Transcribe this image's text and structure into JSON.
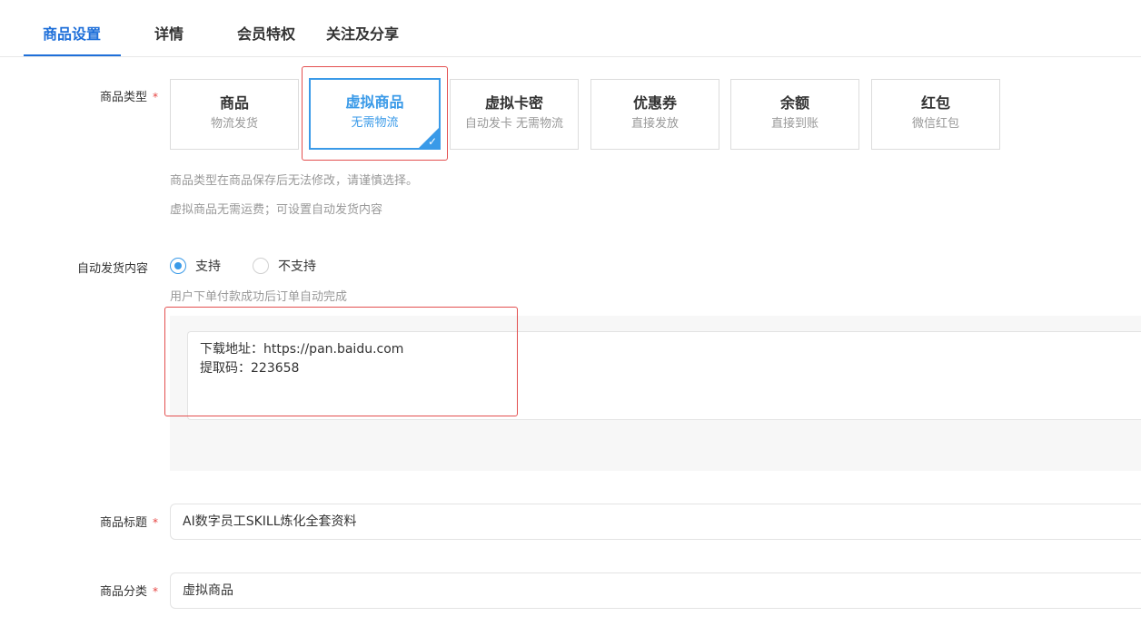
{
  "tabs": [
    {
      "label": "商品设置"
    },
    {
      "label": "详情"
    },
    {
      "label": "会员特权"
    },
    {
      "label": "关注及分享"
    }
  ],
  "product_type": {
    "label": "商品类型",
    "required_mark": "*",
    "options": [
      {
        "title": "商品",
        "subtitle": "物流发货"
      },
      {
        "title": "虚拟商品",
        "subtitle": "无需物流"
      },
      {
        "title": "虚拟卡密",
        "subtitle": "自动发卡 无需物流"
      },
      {
        "title": "优惠券",
        "subtitle": "直接发放"
      },
      {
        "title": "余额",
        "subtitle": "直接到账"
      },
      {
        "title": "红包",
        "subtitle": "微信红包"
      }
    ],
    "selected_index": 1,
    "check_mark": "✓",
    "help_1": "商品类型在商品保存后无法修改，请谨慎选择。",
    "help_2": "虚拟商品无需运费；可设置自动发货内容"
  },
  "auto_delivery": {
    "label": "自动发货内容",
    "options": [
      {
        "label": "支持"
      },
      {
        "label": "不支持"
      }
    ],
    "selected_index": 0,
    "help": "用户下单付款成功后订单自动完成",
    "content": "下载地址：https://pan.baidu.com\n提取码：223658"
  },
  "product_title": {
    "label": "商品标题",
    "required_mark": "*",
    "value": "AI数字员工SKILL炼化全套资料"
  },
  "product_category": {
    "label": "商品分类",
    "required_mark": "*",
    "value": "虚拟商品"
  },
  "colors": {
    "accent": "#1e6fd9",
    "selected": "#3a9ae8",
    "highlight": "#e34f4f",
    "required": "#e64340"
  }
}
